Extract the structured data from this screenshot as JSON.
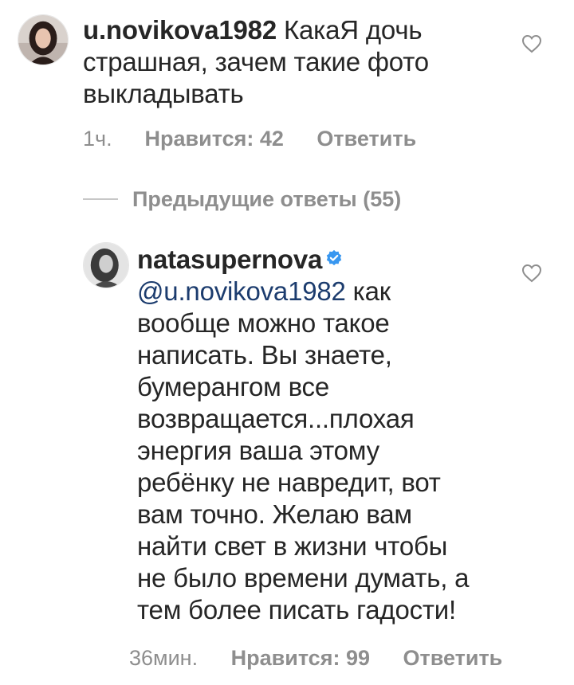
{
  "comment": {
    "username": "u.novikova1982",
    "text_lines": [
      "КакаЯ дочь",
      "страшная, зачем такие фото",
      "выкладывать"
    ],
    "time": "1ч.",
    "likes": "Нравится: 42",
    "reply": "Ответить"
  },
  "previous_replies": {
    "label": "Предыдущие ответы (55)"
  },
  "reply_comment": {
    "username": "natasupernova",
    "mention": "@u.novikova1982",
    "text_lines": [
      "как",
      "вообще можно такое",
      "написать. Вы знаете,",
      "бумерангом все",
      "возвращается...плохая",
      "энергия ваша этому",
      "ребёнку не навредит, вот",
      "вам точно. Желаю вам",
      "найти свет в жизни чтобы",
      "не было времени думать, а",
      "тем более писать гадости!"
    ],
    "time": "36мин.",
    "likes": "Нравится: 99",
    "reply": "Ответить"
  },
  "colors": {
    "text": "#262626",
    "meta": "#8e8e8e",
    "mention": "#1c3c6e",
    "verified": "#3897f0"
  },
  "icons": {
    "like": "heart-outline-icon",
    "verified": "verified-badge-icon"
  }
}
